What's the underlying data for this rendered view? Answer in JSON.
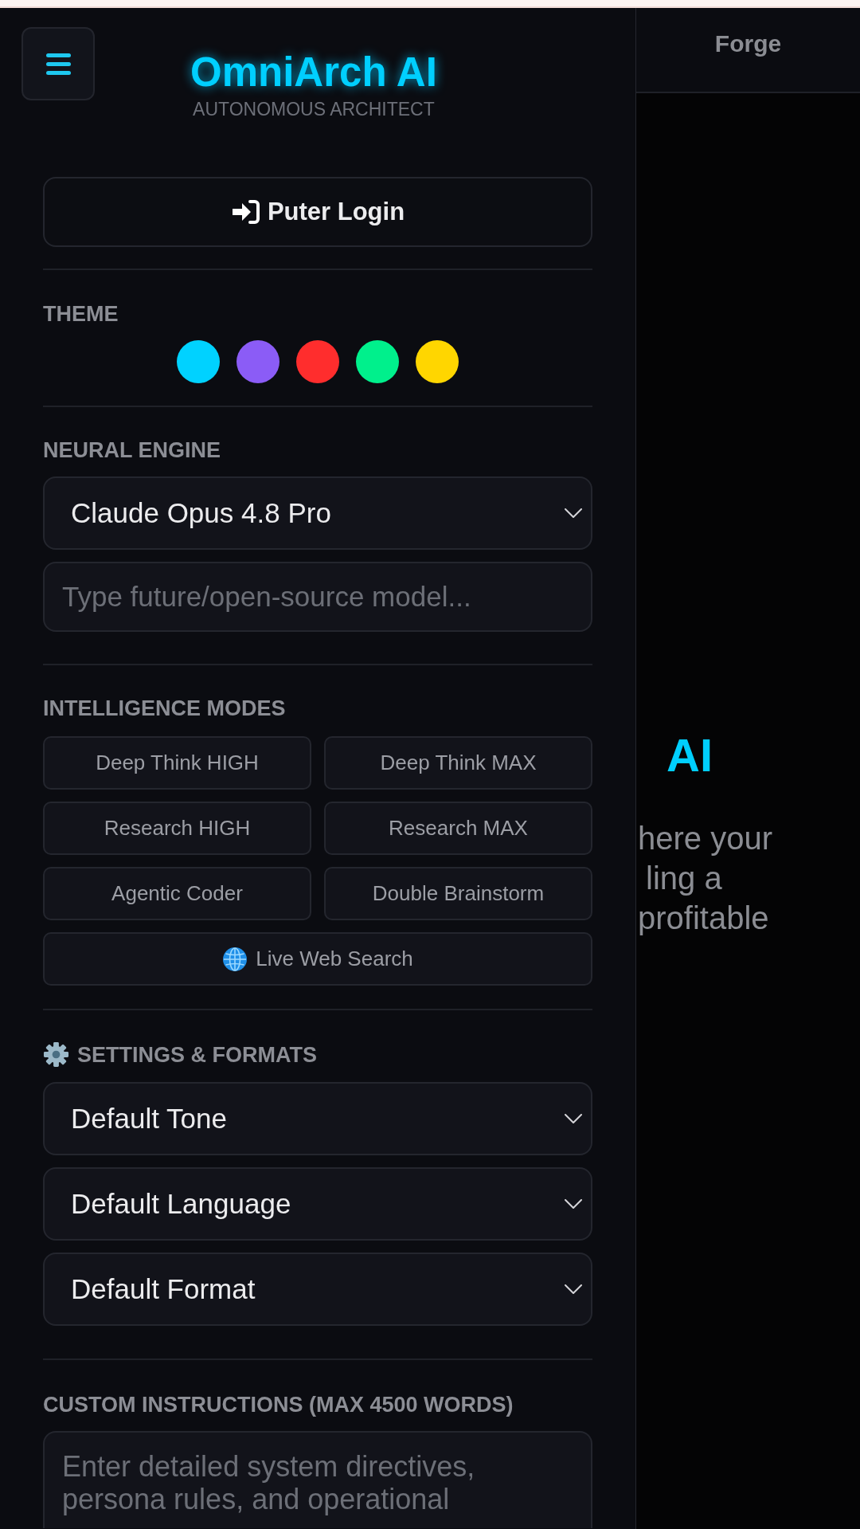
{
  "sidebar": {
    "brand": {
      "title": "OmniArch AI",
      "subtitle": "AUTONOMOUS ARCHITECT"
    },
    "login_button": {
      "label": "Puter Login"
    },
    "theme": {
      "label": "THEME",
      "swatches": [
        {
          "color": "#00d2ff"
        },
        {
          "color": "#8b5cf6"
        },
        {
          "color": "#ff2d2d"
        },
        {
          "color": "#00f08c"
        },
        {
          "color": "#ffd600"
        }
      ]
    },
    "neural_engine": {
      "label": "NEURAL ENGINE",
      "model_select": {
        "value": "Claude Opus 4.8 Pro"
      },
      "custom_model": {
        "placeholder": "Type future/open-source model..."
      }
    },
    "intelligence_modes": {
      "label": "INTELLIGENCE MODES",
      "modes": [
        {
          "label": "Deep Think HIGH",
          "kind": "mode"
        },
        {
          "label": "Deep Think MAX",
          "kind": "mode"
        },
        {
          "label": "Research HIGH",
          "kind": "mode"
        },
        {
          "label": "Research MAX",
          "kind": "mode"
        },
        {
          "label": "Agentic Coder",
          "kind": "mode"
        },
        {
          "label": "Double Brainstorm",
          "kind": "mode"
        },
        {
          "label": "Live Web Search",
          "kind": "web_search"
        }
      ]
    },
    "settings": {
      "label": "SETTINGS & FORMATS",
      "selects": [
        {
          "value": "Default Tone"
        },
        {
          "value": "Default Language"
        },
        {
          "value": "Default Format"
        }
      ]
    },
    "custom_instructions": {
      "label": "CUSTOM INSTRUCTIONS (MAX 4500 WORDS)",
      "placeholder": "Enter detailed system directives, persona rules, and operational"
    }
  },
  "main": {
    "header_title": "Forge",
    "heading": "AI",
    "intro_lines": [
      "here your",
      "ling a",
      "profitable"
    ]
  }
}
